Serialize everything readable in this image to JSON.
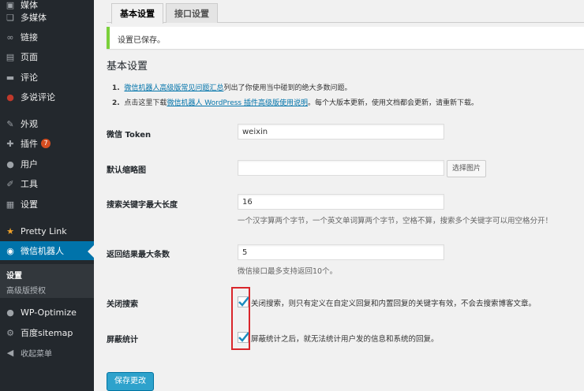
{
  "sidebar": {
    "items": [
      {
        "label": "媒体",
        "icon": "media-icon"
      },
      {
        "label": "多媒体",
        "icon": "media-icon"
      },
      {
        "label": "链接",
        "icon": "link-icon"
      },
      {
        "label": "页面",
        "icon": "page-icon"
      },
      {
        "label": "评论",
        "icon": "comment-icon"
      },
      {
        "label": "多说评论",
        "icon": "duoshuo-icon"
      },
      {
        "label": "外观",
        "icon": "appearance-icon"
      },
      {
        "label": "插件",
        "icon": "plugin-icon",
        "badge": "7"
      },
      {
        "label": "用户",
        "icon": "user-icon"
      },
      {
        "label": "工具",
        "icon": "tools-icon"
      },
      {
        "label": "设置",
        "icon": "settings-icon"
      },
      {
        "label": "Pretty Link",
        "icon": "star-icon"
      },
      {
        "label": "微信机器人",
        "icon": "wechat-icon"
      },
      {
        "label": "WP-Optimize",
        "icon": "optimize-icon"
      },
      {
        "label": "百度sitemap",
        "icon": "gear-icon"
      },
      {
        "label": "收起菜单",
        "icon": "collapse-icon"
      }
    ],
    "submenu": [
      "设置",
      "高级版授权"
    ]
  },
  "tabs": [
    "基本设置",
    "接口设置"
  ],
  "notice": "设置已保存。",
  "heading": "基本设置",
  "notes": {
    "n1_num": "1.",
    "n1_link": "微信机器人高级版常见问题汇总",
    "n1_text": "列出了你使用当中碰到的绝大多数问题。",
    "n2_num": "2.",
    "n2_pre": "点击这里下载",
    "n2_link": "微信机器人 WordPress 插件高级版使用说明",
    "n2_post": "。每个大版本更新，使用文档都会更新，请重新下载。"
  },
  "form": {
    "token_label": "微信 Token",
    "token_value": "weixin",
    "thumb_label": "默认缩略图",
    "thumb_value": "",
    "choose_image": "选择图片",
    "keyword_label": "搜索关键字最大长度",
    "keyword_value": "16",
    "keyword_desc": "一个汉字算两个字节，一个英文单词算两个字节，空格不算，搜索多个关键字可以用空格分开！",
    "results_label": "返回结果最大条数",
    "results_value": "5",
    "results_desc": "微信接口最多支持返回10个。",
    "close_search_label": "关闭搜索",
    "close_search_text": "关闭搜索，则只有定义在自定义回复和内置回复的关键字有效，不会去搜索博客文章。",
    "block_stats_label": "屏蔽统计",
    "block_stats_text": "屏蔽统计之后，就无法统计用户发的信息和系统的回复。"
  },
  "save_button": "保存更改"
}
